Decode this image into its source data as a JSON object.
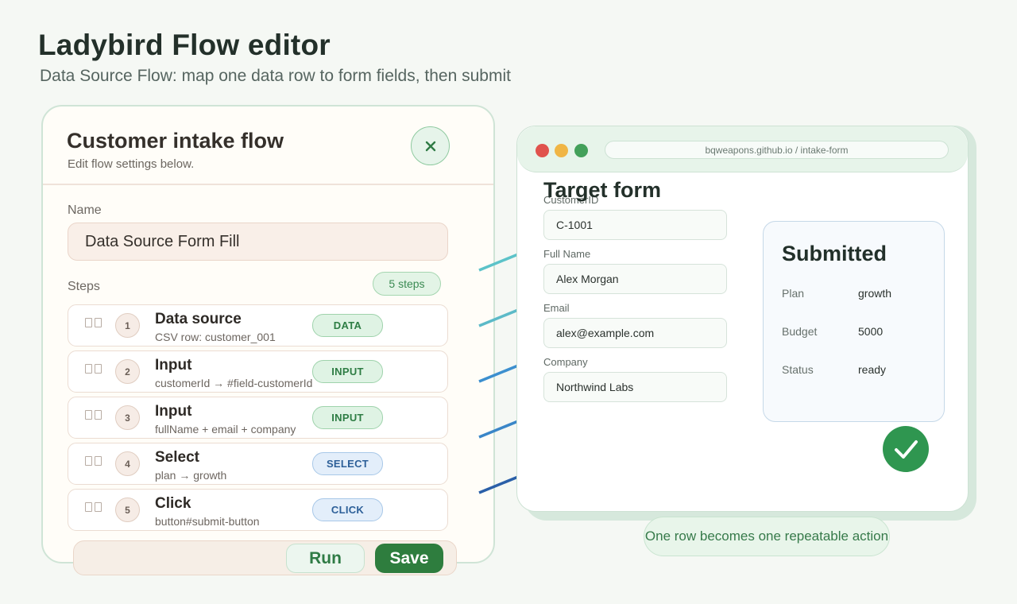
{
  "page": {
    "title": "Ladybird Flow editor",
    "subtitle": "Data Source Flow: map one data row to form fields, then submit"
  },
  "editor": {
    "title": "Customer intake flow",
    "subtitle": "Edit flow settings below.",
    "name_label": "Name",
    "name_value": "Data Source Form Fill",
    "steps_label": "Steps",
    "steps_count": "5 steps",
    "steps": [
      {
        "num": "1",
        "title": "Data source",
        "detail": "CSV row: customer_001",
        "tag": "DATA"
      },
      {
        "num": "2",
        "title": "Input",
        "detail": "customerId → #field-customerId",
        "tag": "INPUT"
      },
      {
        "num": "3",
        "title": "Input",
        "detail": "fullName + email + company",
        "tag": "INPUT"
      },
      {
        "num": "4",
        "title": "Select",
        "detail": "plan → growth",
        "tag": "SELECT"
      },
      {
        "num": "5",
        "title": "Click",
        "detail": "button#submit-button",
        "tag": "CLICK"
      }
    ],
    "run_label": "Run",
    "save_label": "Save"
  },
  "browser": {
    "url": "bqweapons.github.io / intake-form",
    "form_title": "Target form",
    "fields": [
      {
        "label": "CustomerID",
        "value": "C-1001"
      },
      {
        "label": "Full Name",
        "value": "Alex Morgan"
      },
      {
        "label": "Email",
        "value": "alex@example.com"
      },
      {
        "label": "Company",
        "value": "Northwind Labs"
      }
    ],
    "result": {
      "title": "Submitted",
      "rows": [
        {
          "key": "Plan",
          "value": "growth"
        },
        {
          "key": "Budget",
          "value": "5000"
        },
        {
          "key": "Status",
          "value": "ready"
        }
      ]
    }
  },
  "caption": "One row becomes one repeatable action",
  "colors": {
    "accent_green": "#2e7d3e",
    "tag_green": "#2e7d44",
    "tag_blue": "#2c5f98",
    "dot_red": "#e0524d",
    "dot_yellow": "#f0b545",
    "dot_green": "#43a05a"
  }
}
